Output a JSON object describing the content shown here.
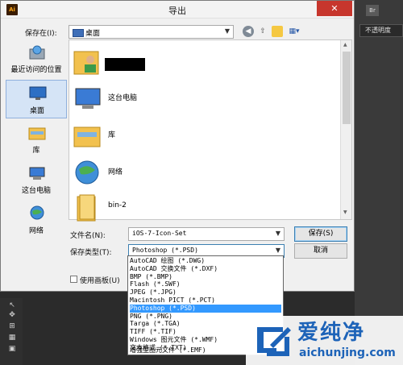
{
  "app": {
    "right_tab": "Br",
    "opacity_label": "不透明度",
    "tools": [
      "↖",
      "✥",
      "⊞",
      "▦",
      "▣"
    ]
  },
  "dialog": {
    "title": "导出",
    "app_icon": "Ai",
    "close_glyph": "✕",
    "save_in_label": "保存在(I):",
    "save_in_value": "桌面",
    "toolbar_icons": [
      "back-icon",
      "up-folder-icon",
      "new-folder-icon",
      "view-menu-icon"
    ],
    "places": [
      {
        "label": "最近访问的位置",
        "icon": "recent-places-icon"
      },
      {
        "label": "桌面",
        "icon": "desktop-icon",
        "selected": true
      },
      {
        "label": "库",
        "icon": "libraries-icon"
      },
      {
        "label": "这台电脑",
        "icon": "computer-icon"
      },
      {
        "label": "网络",
        "icon": "network-icon"
      }
    ],
    "files": [
      {
        "name": "",
        "icon": "user-folder-icon"
      },
      {
        "name": "这台电脑",
        "icon": "computer-icon"
      },
      {
        "name": "库",
        "icon": "libraries-icon"
      },
      {
        "name": "网络",
        "icon": "network-icon"
      },
      {
        "name": "bin-2",
        "icon": "folder-icon"
      }
    ],
    "filename_label": "文件名(N):",
    "filename_value": "iOS-7-Icon-Set",
    "filetype_label": "保存类型(T):",
    "filetype_value": "Photoshop (*.PSD)",
    "save_button": "保存(S)",
    "cancel_button": "取消",
    "use_artboards_label": "使用画板(U)",
    "filetype_options": [
      "AutoCAD 绘图 (*.DWG)",
      "AutoCAD 交换文件 (*.DXF)",
      "BMP (*.BMP)",
      "Flash (*.SWF)",
      "JPEG (*.JPG)",
      "Macintosh PICT (*.PCT)",
      "Photoshop (*.PSD)",
      "PNG (*.PNG)",
      "Targa (*.TGA)",
      "TIFF (*.TIF)",
      "Windows 图元文件 (*.WMF)",
      "文本格式 (*.TXT)",
      "增强型图元文件 (*.EMF)"
    ],
    "selected_option_index": 6
  },
  "watermark": {
    "brand": "爱纯净",
    "url": "aichunjing.com"
  },
  "colors": {
    "accent": "#3399ff",
    "close_red": "#c7362d",
    "folder_yellow": "#f2c14e",
    "watermark_blue": "#1d63b8"
  }
}
